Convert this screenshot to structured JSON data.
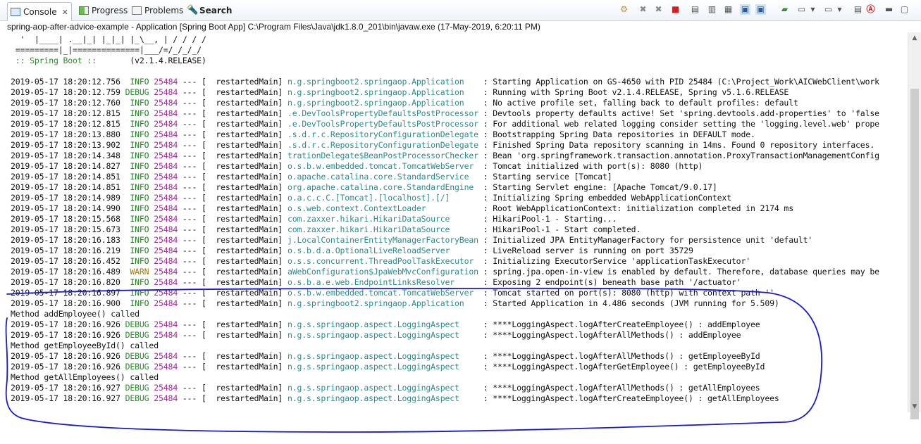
{
  "tabs": [
    {
      "label": "Console",
      "close": "✕",
      "active": true
    },
    {
      "label": "Progress"
    },
    {
      "label": "Problems"
    },
    {
      "label": "Search"
    }
  ],
  "toolbar_icons": [
    "terminate-all-icon",
    "remove-launch-icon",
    "remove-all-icon",
    "stop-icon",
    "clear-console-icon",
    "scroll-lock-icon",
    "word-wrap-icon",
    "show-stdout-icon",
    "show-stderr-icon",
    "pin-console-icon",
    "display-console-icon",
    "open-console-icon",
    "minimize-icon",
    "maximize-icon"
  ],
  "title": "spring-aop-after-advice-example - Application [Spring Boot App] C:\\Program Files\\Java\\jdk1.8.0_201\\bin\\javaw.exe (17-May-2019, 6:20:11 PM)",
  "banner": [
    "  '  |____| .__|_| |_|_| |_\\__, | / / / /",
    " =========|_|==============|___/=/_/_/_/",
    {
      "pre": " :: Spring Boot :: ",
      "version": "      (v2.1.4.RELEASE)"
    }
  ],
  "log": [
    {
      "ts": "2019-05-17 18:20:12.756",
      "lvl": "INFO",
      "pid": "25484",
      "thread": "restartedMain",
      "logger": "n.g.springboot2.springaop.Application",
      "msg": "Starting Application on GS-4650 with PID 25484 (C:\\Project_Work\\AICWebClient\\work"
    },
    {
      "ts": "2019-05-17 18:20:12.759",
      "lvl": "DEBUG",
      "pid": "25484",
      "thread": "restartedMain",
      "logger": "n.g.springboot2.springaop.Application",
      "msg": "Running with Spring Boot v2.1.4.RELEASE, Spring v5.1.6.RELEASE"
    },
    {
      "ts": "2019-05-17 18:20:12.760",
      "lvl": "INFO",
      "pid": "25484",
      "thread": "restartedMain",
      "logger": "n.g.springboot2.springaop.Application",
      "msg": "No active profile set, falling back to default profiles: default"
    },
    {
      "ts": "2019-05-17 18:20:12.815",
      "lvl": "INFO",
      "pid": "25484",
      "thread": "restartedMain",
      "logger": ".e.DevToolsPropertyDefaultsPostProcessor",
      "msg": "Devtools property defaults active! Set 'spring.devtools.add-properties' to 'false"
    },
    {
      "ts": "2019-05-17 18:20:12.815",
      "lvl": "INFO",
      "pid": "25484",
      "thread": "restartedMain",
      "logger": ".e.DevToolsPropertyDefaultsPostProcessor",
      "msg": "For additional web related logging consider setting the 'logging.level.web' prope"
    },
    {
      "ts": "2019-05-17 18:20:13.880",
      "lvl": "INFO",
      "pid": "25484",
      "thread": "restartedMain",
      "logger": ".s.d.r.c.RepositoryConfigurationDelegate",
      "msg": "Bootstrapping Spring Data repositories in DEFAULT mode."
    },
    {
      "ts": "2019-05-17 18:20:13.902",
      "lvl": "INFO",
      "pid": "25484",
      "thread": "restartedMain",
      "logger": ".s.d.r.c.RepositoryConfigurationDelegate",
      "msg": "Finished Spring Data repository scanning in 14ms. Found 0 repository interfaces."
    },
    {
      "ts": "2019-05-17 18:20:14.348",
      "lvl": "INFO",
      "pid": "25484",
      "thread": "restartedMain",
      "logger": "trationDelegate$BeanPostProcessorChecker",
      "msg": "Bean 'org.springframework.transaction.annotation.ProxyTransactionManagementConfig"
    },
    {
      "ts": "2019-05-17 18:20:14.827",
      "lvl": "INFO",
      "pid": "25484",
      "thread": "restartedMain",
      "logger": "o.s.b.w.embedded.tomcat.TomcatWebServer",
      "msg": "Tomcat initialized with port(s): 8080 (http)"
    },
    {
      "ts": "2019-05-17 18:20:14.851",
      "lvl": "INFO",
      "pid": "25484",
      "thread": "restartedMain",
      "logger": "o.apache.catalina.core.StandardService",
      "msg": "Starting service [Tomcat]"
    },
    {
      "ts": "2019-05-17 18:20:14.851",
      "lvl": "INFO",
      "pid": "25484",
      "thread": "restartedMain",
      "logger": "org.apache.catalina.core.StandardEngine",
      "msg": "Starting Servlet engine: [Apache Tomcat/9.0.17]"
    },
    {
      "ts": "2019-05-17 18:20:14.989",
      "lvl": "INFO",
      "pid": "25484",
      "thread": "restartedMain",
      "logger": "o.a.c.c.C.[Tomcat].[localhost].[/]",
      "msg": "Initializing Spring embedded WebApplicationContext"
    },
    {
      "ts": "2019-05-17 18:20:14.990",
      "lvl": "INFO",
      "pid": "25484",
      "thread": "restartedMain",
      "logger": "o.s.web.context.ContextLoader",
      "msg": "Root WebApplicationContext: initialization completed in 2174 ms"
    },
    {
      "ts": "2019-05-17 18:20:15.568",
      "lvl": "INFO",
      "pid": "25484",
      "thread": "restartedMain",
      "logger": "com.zaxxer.hikari.HikariDataSource",
      "msg": "HikariPool-1 - Starting..."
    },
    {
      "ts": "2019-05-17 18:20:15.673",
      "lvl": "INFO",
      "pid": "25484",
      "thread": "restartedMain",
      "logger": "com.zaxxer.hikari.HikariDataSource",
      "msg": "HikariPool-1 - Start completed."
    },
    {
      "ts": "2019-05-17 18:20:16.183",
      "lvl": "INFO",
      "pid": "25484",
      "thread": "restartedMain",
      "logger": "j.LocalContainerEntityManagerFactoryBean",
      "msg": "Initialized JPA EntityManagerFactory for persistence unit 'default'"
    },
    {
      "ts": "2019-05-17 18:20:16.219",
      "lvl": "INFO",
      "pid": "25484",
      "thread": "restartedMain",
      "logger": "o.s.b.d.a.OptionalLiveReloadServer",
      "msg": "LiveReload server is running on port 35729"
    },
    {
      "ts": "2019-05-17 18:20:16.452",
      "lvl": "INFO",
      "pid": "25484",
      "thread": "restartedMain",
      "logger": "o.s.s.concurrent.ThreadPoolTaskExecutor",
      "msg": "Initializing ExecutorService 'applicationTaskExecutor'"
    },
    {
      "ts": "2019-05-17 18:20:16.489",
      "lvl": "WARN",
      "pid": "25484",
      "thread": "restartedMain",
      "logger": "aWebConfiguration$JpaWebMvcConfiguration",
      "msg": "spring.jpa.open-in-view is enabled by default. Therefore, database queries may be"
    },
    {
      "ts": "2019-05-17 18:20:16.820",
      "lvl": "INFO",
      "pid": "25484",
      "thread": "restartedMain",
      "logger": "o.s.b.a.e.web.EndpointLinksResolver",
      "msg": "Exposing 2 endpoint(s) beneath base path '/actuator'"
    },
    {
      "ts": "2019-05-17 18:20:16.897",
      "lvl": "INFO",
      "pid": "25484",
      "thread": "restartedMain",
      "logger": "o.s.b.w.embedded.tomcat.TomcatWebServer",
      "msg": "Tomcat started on port(s): 8080 (http) with context path ''"
    },
    {
      "ts": "2019-05-17 18:20:16.900",
      "lvl": "INFO",
      "pid": "25484",
      "thread": "restartedMain",
      "logger": "n.g.springboot2.springaop.Application",
      "msg": "Started Application in 4.486 seconds (JVM running for 5.509)"
    },
    {
      "plain": "Method addEmployee() called"
    },
    {
      "ts": "2019-05-17 18:20:16.926",
      "lvl": "DEBUG",
      "pid": "25484",
      "thread": "restartedMain",
      "logger": "n.g.s.springaop.aspect.LoggingAspect",
      "msg": "****LoggingAspect.logAfterCreateEmployee() : addEmployee"
    },
    {
      "ts": "2019-05-17 18:20:16.926",
      "lvl": "DEBUG",
      "pid": "25484",
      "thread": "restartedMain",
      "logger": "n.g.s.springaop.aspect.LoggingAspect",
      "msg": "****LoggingAspect.logAfterAllMethods() : addEmployee"
    },
    {
      "plain": "Method getEmployeeById() called"
    },
    {
      "ts": "2019-05-17 18:20:16.926",
      "lvl": "DEBUG",
      "pid": "25484",
      "thread": "restartedMain",
      "logger": "n.g.s.springaop.aspect.LoggingAspect",
      "msg": "****LoggingAspect.logAfterAllMethods() : getEmployeeById"
    },
    {
      "ts": "2019-05-17 18:20:16.926",
      "lvl": "DEBUG",
      "pid": "25484",
      "thread": "restartedMain",
      "logger": "n.g.s.springaop.aspect.LoggingAspect",
      "msg": "****LoggingAspect.logAfterGetEmployee() : getEmployeeById"
    },
    {
      "plain": "Method getAllEmployees() called"
    },
    {
      "ts": "2019-05-17 18:20:16.927",
      "lvl": "DEBUG",
      "pid": "25484",
      "thread": "restartedMain",
      "logger": "n.g.s.springaop.aspect.LoggingAspect",
      "msg": "****LoggingAspect.logAfterAllMethods() : getAllEmployees"
    },
    {
      "ts": "2019-05-17 18:20:16.927",
      "lvl": "DEBUG",
      "pid": "25484",
      "thread": "restartedMain",
      "logger": "n.g.s.springaop.aspect.LoggingAspect",
      "msg": "****LoggingAspect.logAfterCreateEmployee() : getAllEmployees"
    }
  ],
  "colors": {
    "info": "#208020",
    "debug": "#2f8a2f",
    "warn": "#a07a00",
    "pid": "#a02898",
    "logger": "#2d8c8c",
    "annotation": "#1a1acc"
  }
}
